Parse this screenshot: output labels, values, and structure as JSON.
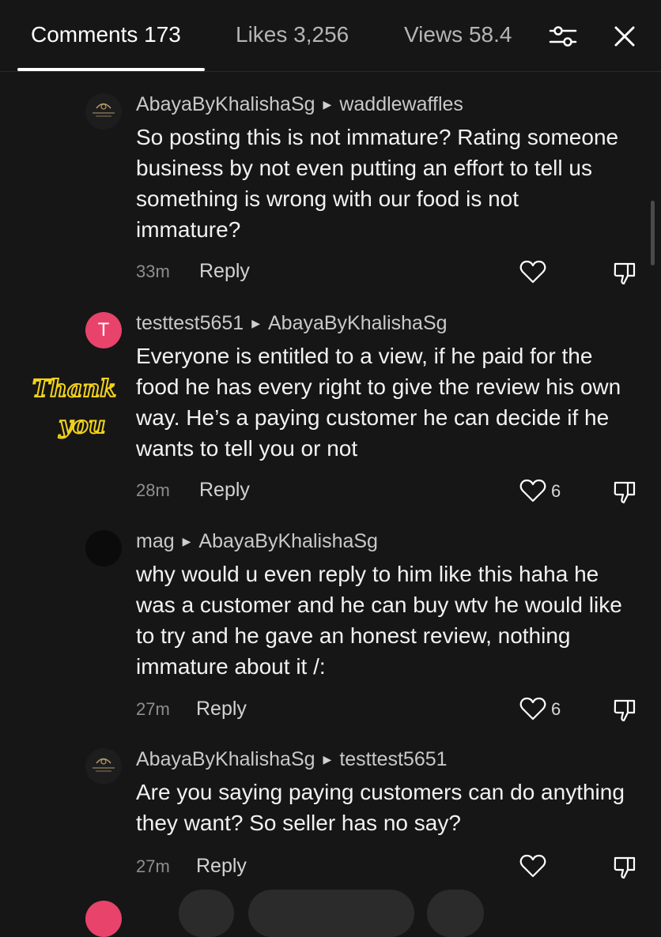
{
  "tabs": {
    "comments_label": "Comments 173",
    "likes_label": "Likes 3,256",
    "views_label": "Views 58.4"
  },
  "icons": {
    "filter": "sliders-icon",
    "close": "close-icon",
    "like": "heart-icon",
    "dislike": "thumbs-down-icon"
  },
  "sticker": {
    "line1": "Thank",
    "line2": "you",
    "color": "#f2d21b"
  },
  "comments": [
    {
      "author": "AbayaByKhalishaSg",
      "reply_to": "waddlewaffles",
      "text": "So posting this is not immature? Rating someone business by not even putting an effort to tell us something is wrong with our food is not immature?",
      "time": "33m",
      "reply_label": "Reply",
      "likes": ""
    },
    {
      "avatar_letter": "T",
      "author": "testtest5651",
      "reply_to": "AbayaByKhalishaSg",
      "text": "Everyone is entitled to a view, if he paid for the food he has every right to give the review his own way. He’s a paying customer he can decide if he wants to tell you or not",
      "time": "28m",
      "reply_label": "Reply",
      "likes": "6"
    },
    {
      "author": "mag",
      "reply_to": "AbayaByKhalishaSg",
      "text": "why would u even reply to him like this haha he was a customer and he can buy wtv he would like to try and he gave an honest review, nothing immature about it /:",
      "time": "27m",
      "reply_label": "Reply",
      "likes": "6"
    },
    {
      "author": "AbayaByKhalishaSg",
      "reply_to": "testtest5651",
      "text": "Are you saying paying customers can do anything they want? So seller has no say?",
      "time": "27m",
      "reply_label": "Reply",
      "likes": ""
    }
  ],
  "colors": {
    "background": "#161616",
    "avatar_pink": "#e8436b"
  }
}
